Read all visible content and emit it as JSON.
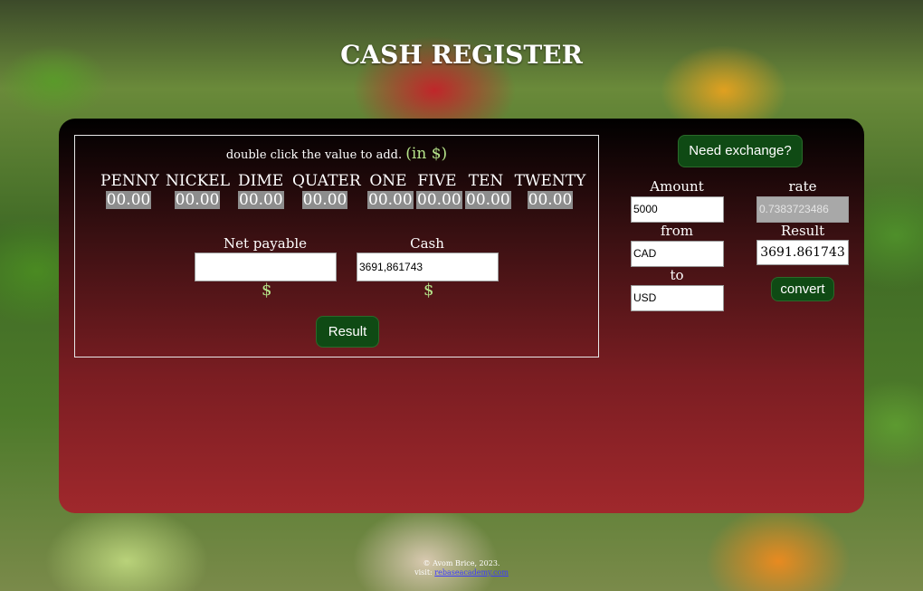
{
  "header": {
    "title": "CASH REGISTER"
  },
  "register": {
    "hint": "double click the value to add.",
    "unit": "(in $)",
    "denominations": [
      {
        "name": "PENNY",
        "value": "00.00"
      },
      {
        "name": "NICKEL",
        "value": "00.00"
      },
      {
        "name": "DIME",
        "value": "00.00"
      },
      {
        "name": "QUATER",
        "value": "00.00"
      },
      {
        "name": "ONE",
        "value": "00.00"
      },
      {
        "name": "FIVE",
        "value": "00.00"
      },
      {
        "name": "TEN",
        "value": "00.00"
      },
      {
        "name": "TWENTY",
        "value": "00.00"
      }
    ],
    "net_payable": {
      "label": "Net payable",
      "value": "",
      "currency": "$"
    },
    "cash": {
      "label": "Cash",
      "value": "3691,861743",
      "currency": "$"
    },
    "result_button": "Result"
  },
  "exchange": {
    "toggle_button": "Need exchange?",
    "amount": {
      "label": "Amount",
      "value": "5000"
    },
    "from": {
      "label": "from",
      "value": "CAD"
    },
    "to": {
      "label": "to",
      "value": "USD"
    },
    "rate": {
      "label": "rate",
      "value": "0.7383723486"
    },
    "result": {
      "label": "Result",
      "value": "3691.861743"
    },
    "convert_button": "convert"
  },
  "footer": {
    "copyright": "© Avom Brice, 2023.",
    "visit_prefix": "visit:",
    "link_text": "rebaseacademy.com"
  },
  "colors": {
    "button_bg": "#0f4a14",
    "accent_text": "#b6e58a",
    "panel_top": "#000000",
    "panel_bottom": "#a0282c"
  }
}
